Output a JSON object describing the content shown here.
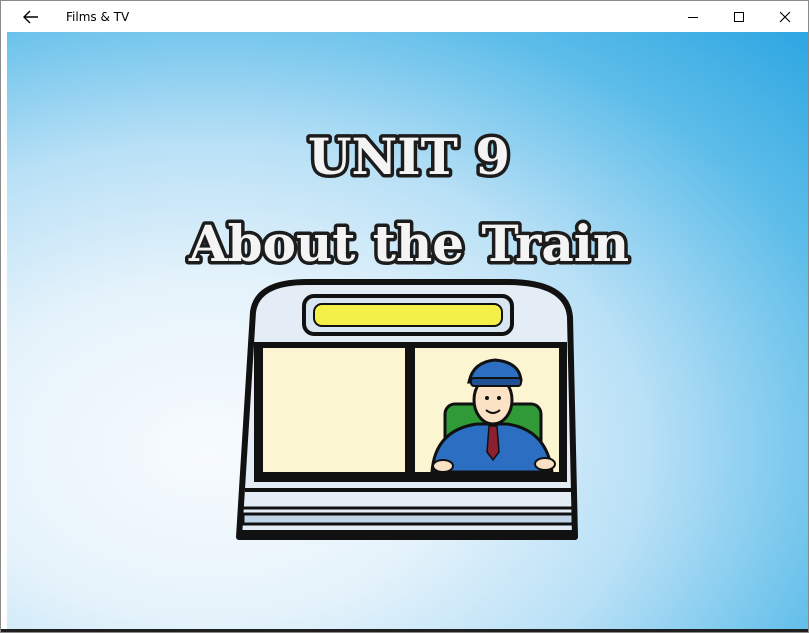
{
  "window": {
    "title": "Films & TV",
    "back_icon": "back-arrow-icon",
    "controls": [
      "minimize-icon",
      "maximize-icon",
      "close-icon"
    ]
  },
  "video": {
    "title_line_1": "UNIT 9",
    "title_line_2": "About the Train",
    "colors": {
      "sky_light": "#f7fbfe",
      "sky_blue": "#2da6e2",
      "train_body": "#e4edf5",
      "train_outline": "#111111",
      "headlight": "#f4f04a",
      "window_fill": "#fcf5d2",
      "driver_uniform": "#2c6fc2",
      "seat": "#2f9a36"
    }
  }
}
